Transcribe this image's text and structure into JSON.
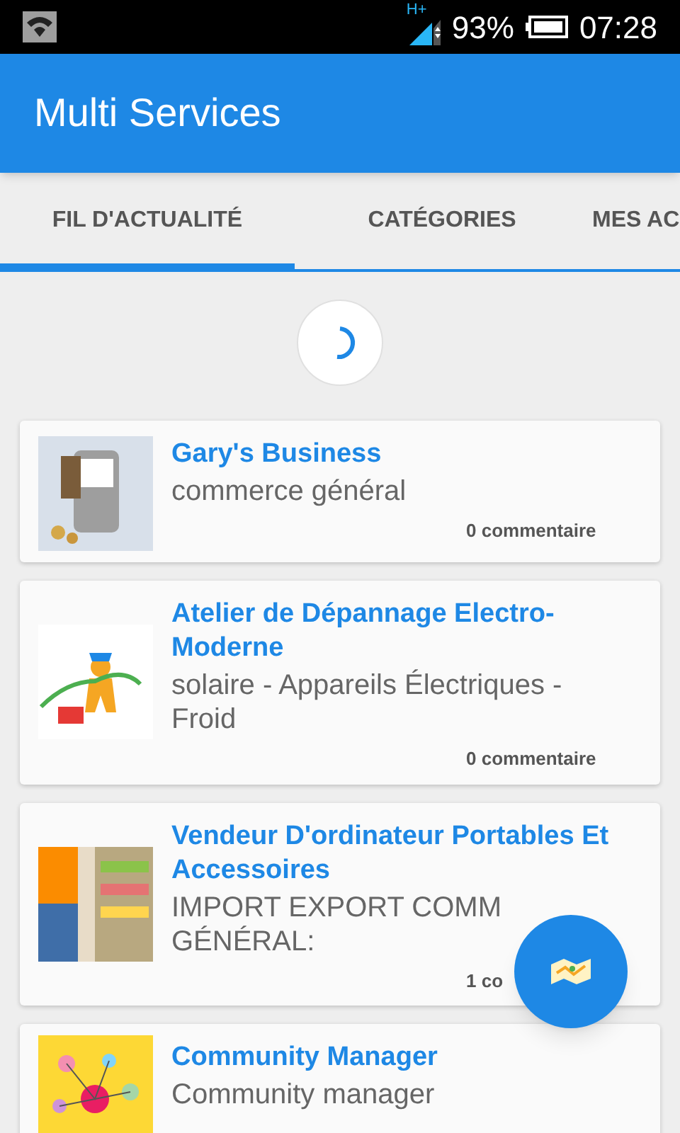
{
  "status_bar": {
    "network": "H+",
    "battery": "93%",
    "time": "07:28"
  },
  "app_bar": {
    "title": "Multi Services"
  },
  "tabs": [
    {
      "label": "FIL D'ACTUALITÉ",
      "selected": true
    },
    {
      "label": "CATÉGORIES",
      "selected": false
    },
    {
      "label": "MES AC",
      "selected": false
    }
  ],
  "loading": true,
  "posts": [
    {
      "title": "Gary's Business",
      "description": "commerce général",
      "comments": "0 commentaire"
    },
    {
      "title": "Atelier de Dépannage Electro-Moderne",
      "description": "solaire - Appareils Électriques -\nFroid",
      "comments": "0 commentaire"
    },
    {
      "title": "Vendeur D'ordinateur Portables Et Accessoires",
      "description": "IMPORT EXPORT COMM\nGÉNÉRAL:",
      "comments": "1 co"
    },
    {
      "title": "Community Manager",
      "description": "Community manager"
    }
  ]
}
